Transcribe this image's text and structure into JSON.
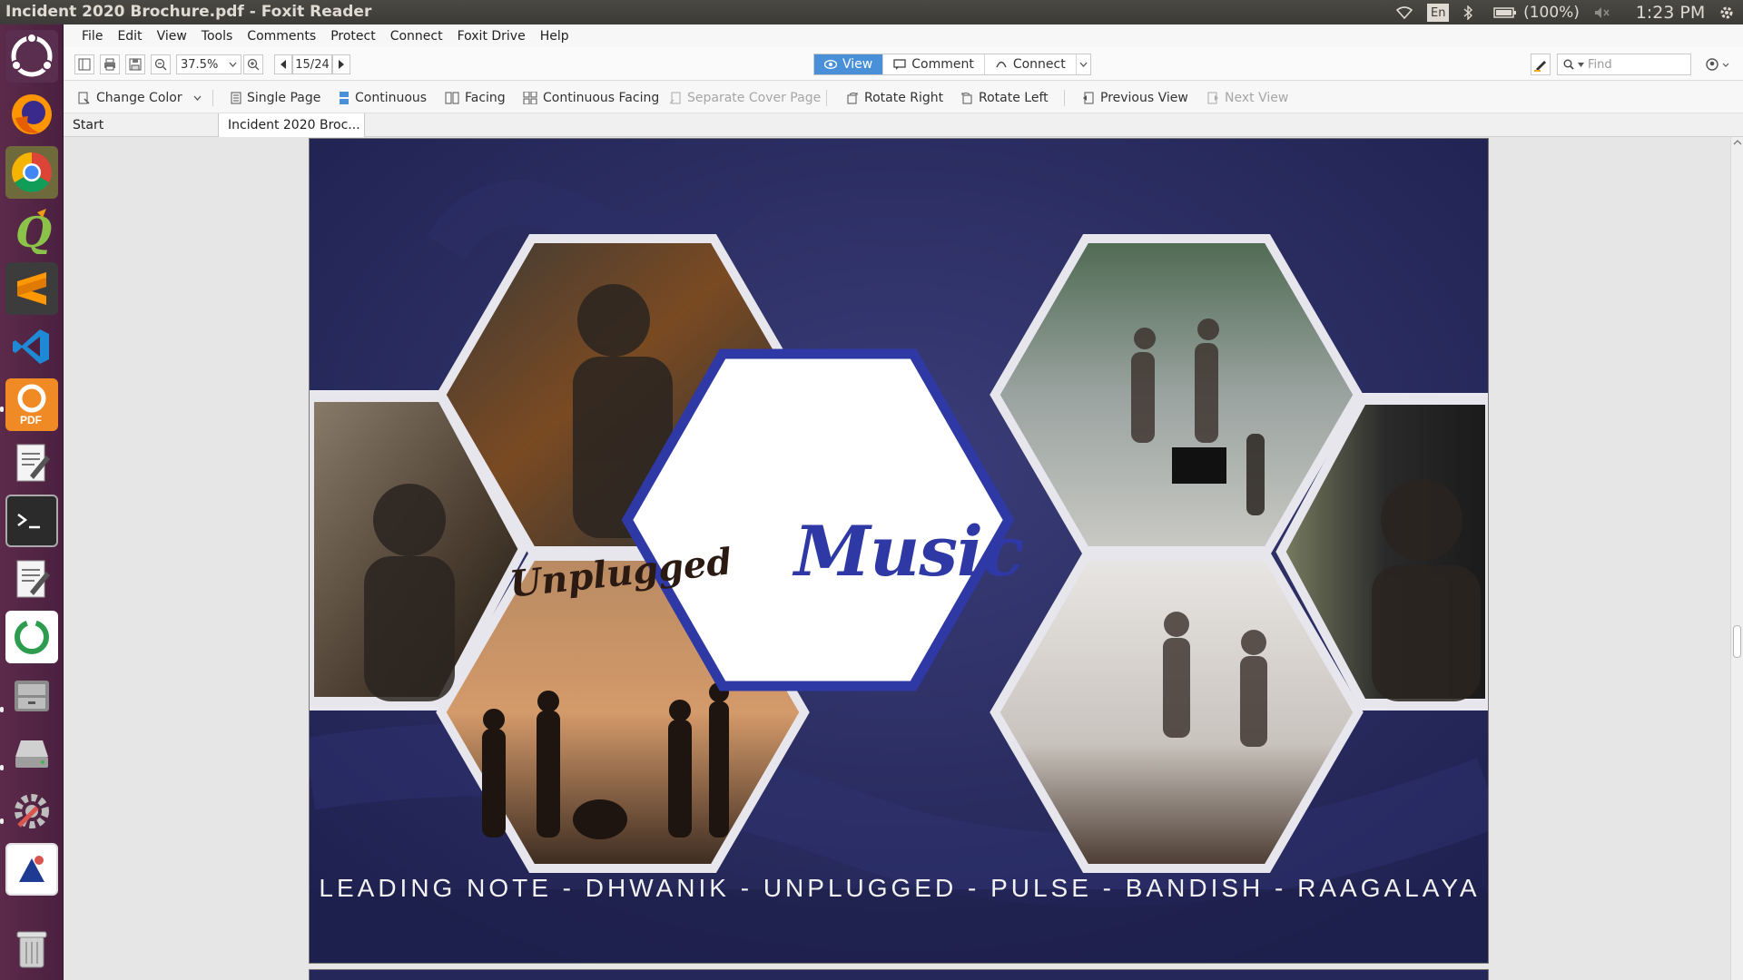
{
  "window": {
    "title": "Incident 2020 Brochure.pdf - Foxit Reader"
  },
  "system_tray": {
    "keyboard": "En",
    "battery": "(100%)",
    "clock": "1:23 PM"
  },
  "launcher": {
    "items": [
      {
        "name": "ubuntu-dash-icon"
      },
      {
        "name": "firefox-icon"
      },
      {
        "name": "chrome-icon"
      },
      {
        "name": "qgis-icon"
      },
      {
        "name": "sublime-text-icon"
      },
      {
        "name": "vscode-icon"
      },
      {
        "name": "foxit-reader-icon",
        "label": "PDF"
      },
      {
        "name": "text-editor-icon"
      },
      {
        "name": "terminal-icon"
      },
      {
        "name": "text-editor-2-icon"
      },
      {
        "name": "sync-icon"
      },
      {
        "name": "file-cabinet-icon"
      },
      {
        "name": "disk-icon"
      },
      {
        "name": "system-settings-icon"
      },
      {
        "name": "custom-app-icon"
      },
      {
        "name": "trash-icon"
      }
    ]
  },
  "menubar": {
    "items": [
      "File",
      "Edit",
      "View",
      "Tools",
      "Comments",
      "Protect",
      "Connect",
      "Foxit Drive",
      "Help"
    ]
  },
  "toolbar": {
    "zoom": "37.5%",
    "page_indicator": "15/24",
    "modes": {
      "view": "View",
      "comment": "Comment",
      "connect": "Connect"
    },
    "find_placeholder": "Find"
  },
  "view_toolbar": {
    "change_color": "Change Color",
    "single_page": "Single Page",
    "continuous": "Continuous",
    "facing": "Facing",
    "continuous_facing": "Continuous Facing",
    "separate_cover": "Separate Cover Page",
    "rotate_right": "Rotate Right",
    "rotate_left": "Rotate Left",
    "previous_view": "Previous View",
    "next_view": "Next View"
  },
  "tabs": {
    "start": "Start",
    "document": "Incident 2020 Broc..."
  },
  "page": {
    "title": "Music",
    "photo_text": "Unplugged",
    "footer": "LEADING NOTE - DHWANIK - UNPLUGGED - PULSE - BANDISH - RAAGALAYA"
  },
  "colors": {
    "page_bg": "#25275a",
    "accent": "#2f39a5",
    "launcher": "#5c2a4a",
    "active_mode": "#4a90d9"
  }
}
